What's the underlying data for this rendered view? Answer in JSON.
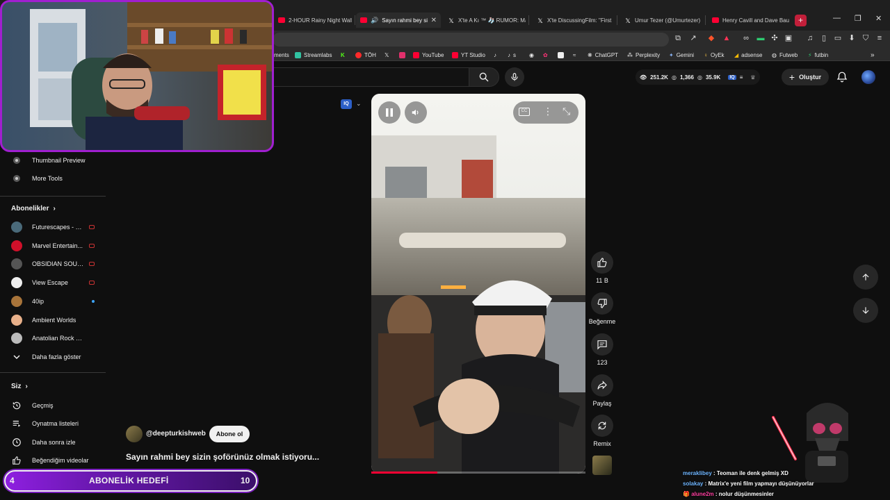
{
  "browser": {
    "tabs": [
      {
        "title": "2-HOUR Rainy Night Walk",
        "icon": "youtube",
        "active": false
      },
      {
        "title": "Sayın rahmi bey sizin",
        "icon": "youtube",
        "active": true
      },
      {
        "title": "X'te A Kı ™ 🧦 RUMOR: Ma",
        "icon": "x",
        "active": false
      },
      {
        "title": "X'te DiscussingFilm: \"First",
        "icon": "x",
        "active": false
      },
      {
        "title": "Umur Tezer (@Umurtezer)",
        "icon": "x",
        "active": false
      },
      {
        "title": "Henry Cavill and Dave Bau",
        "icon": "youtube",
        "active": false
      }
    ],
    "new_tab": "+",
    "window_controls": {
      "minimize": "—",
      "restore": "❐",
      "close": "✕"
    },
    "bookmarks": [
      {
        "label": "ments",
        "color": ""
      },
      {
        "label": "Streamlabs",
        "color": "#31c3a2"
      },
      {
        "label": "",
        "color": "#53fc18"
      },
      {
        "label": "TÖH",
        "color": "#ff2a2a"
      },
      {
        "label": "",
        "color": "#000000"
      },
      {
        "label": "",
        "color": "#e1306c"
      },
      {
        "label": "YouTube",
        "color": "#ff0033"
      },
      {
        "label": "YT Studio",
        "color": "#ff0033"
      },
      {
        "label": "s",
        "color": "#ffffff"
      },
      {
        "label": "ChatGPT",
        "color": "#ffffff"
      },
      {
        "label": "Perplexity",
        "color": "#20b8cd"
      },
      {
        "label": "Gemini",
        "color": "#8ab4f8"
      },
      {
        "label": "OyEk",
        "color": "#f6c343"
      },
      {
        "label": "adsense",
        "color": "#fbbc04"
      },
      {
        "label": "Futweb",
        "color": "#cccccc"
      },
      {
        "label": "futbin",
        "color": "#2ecc71"
      }
    ],
    "more_bookmarks": "»"
  },
  "header": {
    "stats": {
      "views": "251.2K",
      "watch": "1,366",
      "subs": "35.9K"
    },
    "create_label": "Oluştur"
  },
  "sidebar": {
    "tools": [
      {
        "label": "Thumbnail Preview"
      },
      {
        "label": "More Tools"
      }
    ],
    "subscriptions_title": "Abonelikler",
    "subscriptions": [
      {
        "label": "Futurescapes - S...",
        "color": "#4a6a7a",
        "status": "live"
      },
      {
        "label": "Marvel Entertain...",
        "color": "#d0102a",
        "status": "live"
      },
      {
        "label": "OBSIDIAN SOUN...",
        "color": "#555555",
        "status": "live"
      },
      {
        "label": "View Escape",
        "color": "#eeeeee",
        "status": "live"
      },
      {
        "label": "40ip",
        "color": "#a8743a",
        "status": "new"
      },
      {
        "label": "Ambient Worlds",
        "color": "#e8b08a",
        "status": ""
      },
      {
        "label": "Anatolian Rock Rev...",
        "color": "#bbbbbb",
        "status": ""
      }
    ],
    "show_more": "Daha fazla göster",
    "you_title": "Siz",
    "you_items": [
      {
        "label": "Geçmiş",
        "icon": "history-icon"
      },
      {
        "label": "Oynatma listeleri",
        "icon": "playlist-icon"
      },
      {
        "label": "Daha sonra izle",
        "icon": "clock-icon"
      },
      {
        "label": "Beğendiğim videolar",
        "icon": "like-icon"
      }
    ]
  },
  "player": {
    "badge": "IQ",
    "progress": 0.31,
    "actions": [
      {
        "label": "11 B",
        "icon": "like-icon"
      },
      {
        "label": "Beğenme",
        "icon": "dislike-icon"
      },
      {
        "label": "123",
        "icon": "comment-icon"
      },
      {
        "label": "Paylaş",
        "icon": "share-icon"
      },
      {
        "label": "Remix",
        "icon": "remix-icon"
      }
    ]
  },
  "video": {
    "channel": "@deepturkishweb",
    "subscribe_label": "Abone ol",
    "title": "Sayın rahmi bey sizin şoförünüz olmak istiyoru..."
  },
  "overlay": {
    "goal_label": "ABONELİK HEDEFİ",
    "goal_current": "4",
    "goal_target": "10",
    "chat": [
      {
        "user": "meraklibey",
        "message": "Teoman ile denk gelmiş XD",
        "badge": ""
      },
      {
        "user": "solakay",
        "message": "Matrix'e yeni film yapmayı düşünüyorlar",
        "badge": ""
      },
      {
        "user": "alune2m",
        "message": "nolur düşünmesinler",
        "badge": "🎁"
      }
    ]
  }
}
